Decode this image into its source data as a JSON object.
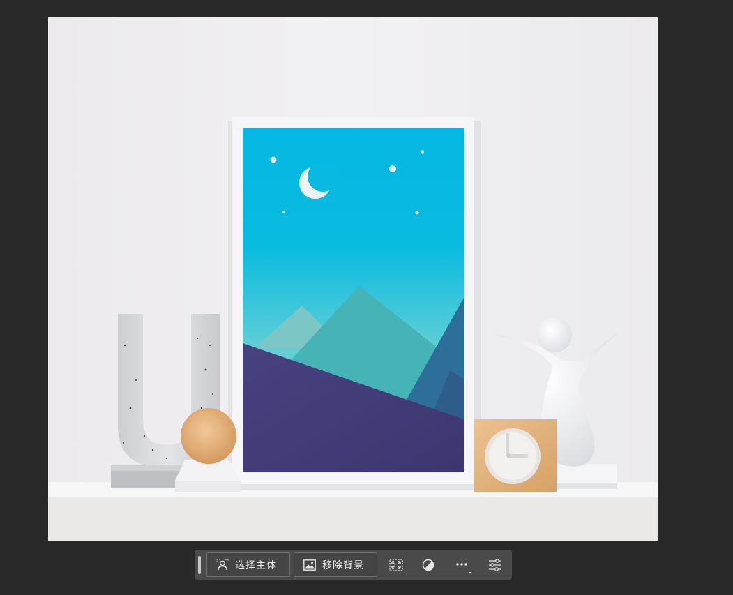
{
  "app": {
    "theme_background": "#282828",
    "taskbar_background": "#4a4a4a"
  },
  "canvas": {
    "scene": "photo-frame-mockup-on-shelf",
    "palette": {
      "wall": "#efeef0",
      "shelf": "#f4f3f2",
      "sky_top": "#06b9e2",
      "sky_bottom": "#7fd4d0",
      "ground": "#443e78",
      "wood": "#e2b27c"
    }
  },
  "contextual_taskbar": {
    "select_subject_label": "选择主体",
    "remove_background_label": "移除背景",
    "icons": {
      "select_subject": "person-selection-icon",
      "remove_background": "image-icon",
      "transform": "transform-selection-icon",
      "adjust": "contrast-circle-icon",
      "more": "more-options-icon",
      "settings": "sliders-icon"
    }
  }
}
